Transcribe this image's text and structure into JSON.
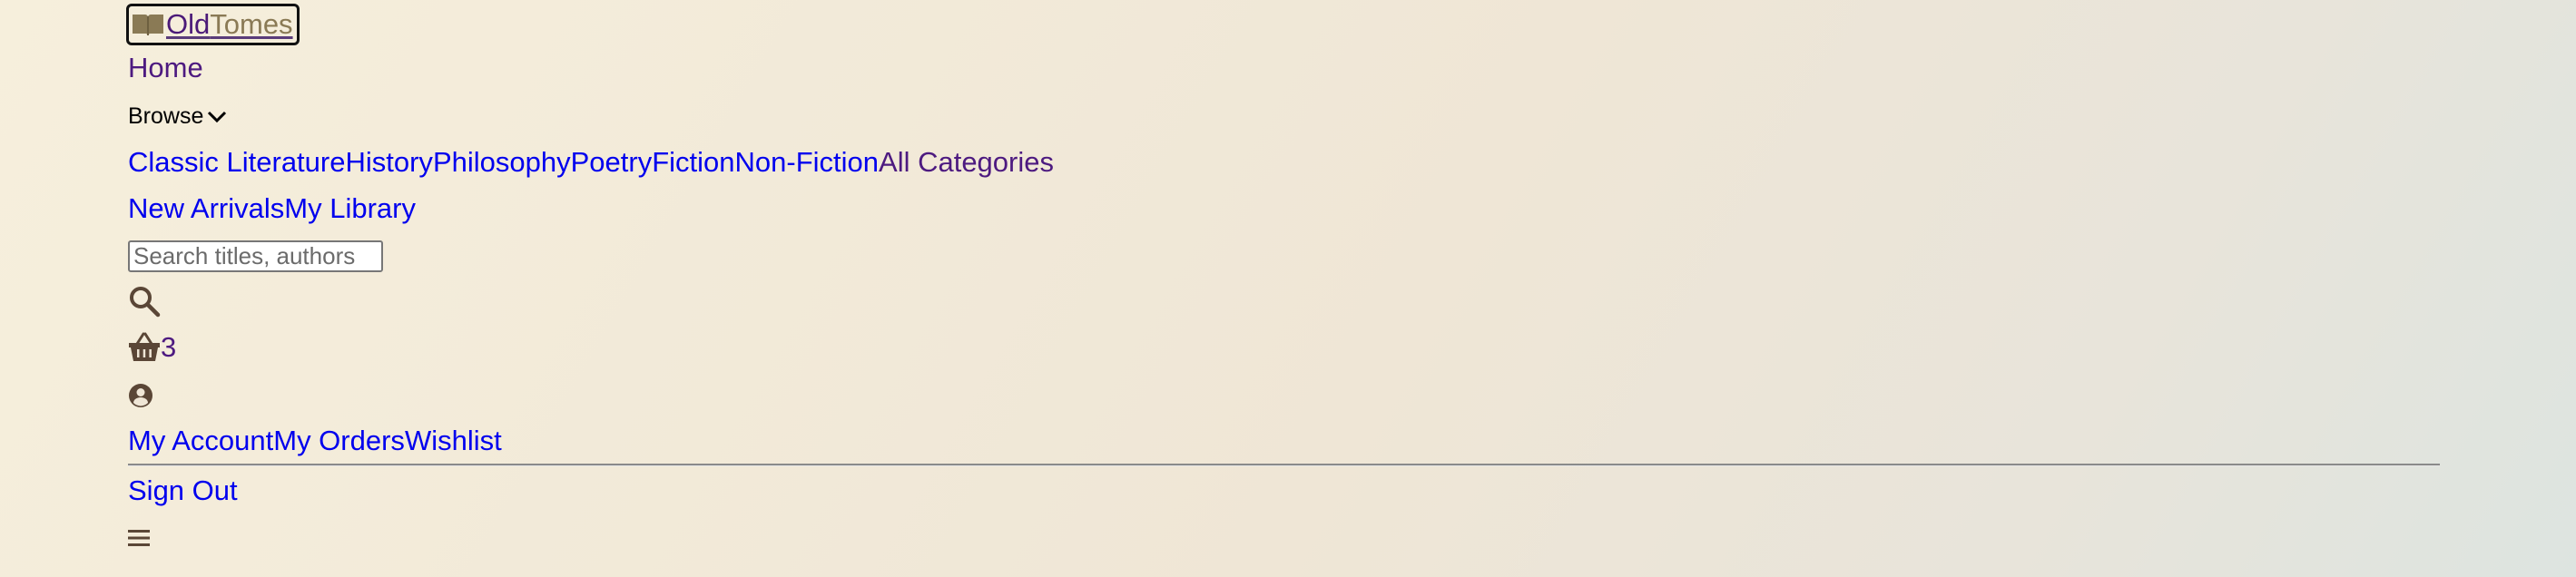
{
  "brand": {
    "part1": "Old",
    "part2": "Tomes"
  },
  "nav": {
    "home": "Home",
    "browse": "Browse",
    "categories": [
      "Classic Literature",
      "History",
      "Philosophy",
      "Poetry",
      "Fiction",
      "Non-Fiction"
    ],
    "all_categories": "All Categories",
    "secondary": [
      "New Arrivals",
      "My Library"
    ]
  },
  "search": {
    "placeholder": "Search titles, authors"
  },
  "cart": {
    "count": "3"
  },
  "account_menu": {
    "items": [
      "My Account",
      "My Orders",
      "Wishlist"
    ],
    "sign_out": "Sign Out"
  },
  "icons": {
    "logo": "open-book-icon",
    "browse_caret": "chevron-down-icon",
    "search": "search-icon",
    "cart": "basket-icon",
    "user": "user-circle-icon",
    "menu": "hamburger-menu-icon"
  },
  "colors": {
    "visited_link": "#4d1a80",
    "link": "#0000ee",
    "icon": "#5a4636",
    "logo_tomes": "#8a7a55"
  }
}
